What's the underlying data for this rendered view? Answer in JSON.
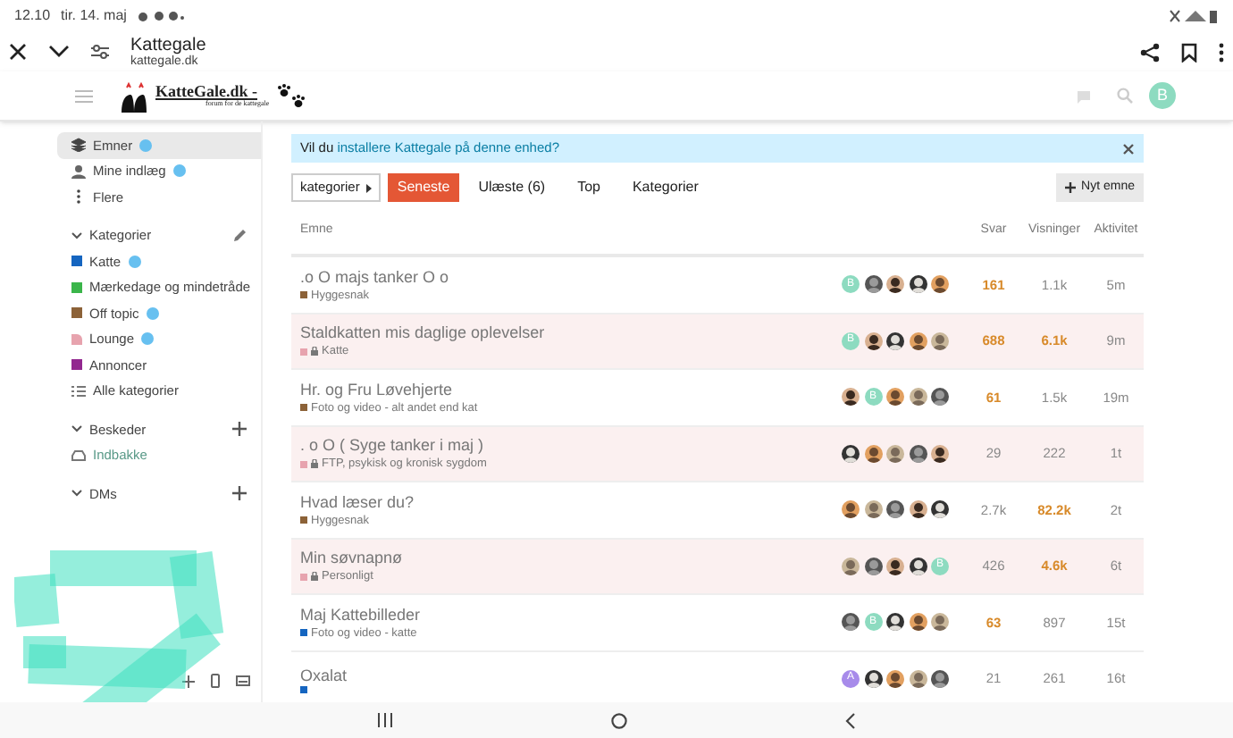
{
  "status_bar": {
    "time": "12.10",
    "date": "tir. 14. maj"
  },
  "browser": {
    "title": "Kattegale",
    "url": "kattegale.dk"
  },
  "site": {
    "logo_title": "KatteGale.dk -",
    "logo_subtitle": "forum for de kattegale",
    "user_initial": "B"
  },
  "sidebar": {
    "items": [
      {
        "label": "Emner",
        "selected": true,
        "unread": true
      },
      {
        "label": "Mine indlæg",
        "selected": false,
        "unread": true
      },
      {
        "label": "Flere",
        "selected": false,
        "unread": false
      }
    ],
    "categories_heading": "Kategorier",
    "categories": [
      {
        "label": "Katte",
        "color": "#1565c0",
        "unread": true,
        "locked": false
      },
      {
        "label": "Mærkedage og mindetråde",
        "color": "#3ab54a",
        "unread": false,
        "locked": false
      },
      {
        "label": "Off topic",
        "color": "#8c6238",
        "unread": true,
        "locked": false
      },
      {
        "label": "Lounge",
        "color": "#e7a3ae",
        "unread": true,
        "locked": true
      },
      {
        "label": "Annoncer",
        "color": "#92278f",
        "unread": false,
        "locked": false
      }
    ],
    "all_categories": "Alle kategorier",
    "messages_heading": "Beskeder",
    "inbox": "Indbakke",
    "dms_heading": "DMs"
  },
  "banner": {
    "text": "Vil du ",
    "link": "installere Kattegale på denne enhed?"
  },
  "toolbar": {
    "dropdown": "kategorier",
    "tabs": [
      {
        "label": "Seneste",
        "selected": true
      },
      {
        "label": "Ulæste (6)",
        "selected": false
      },
      {
        "label": "Top",
        "selected": false
      },
      {
        "label": "Kategorier",
        "selected": false
      }
    ],
    "new_topic": "Nyt emne"
  },
  "table": {
    "columns": [
      "Emne",
      "Svar",
      "Visninger",
      "Aktivitet"
    ],
    "rows": [
      {
        "title": ".o O majs tanker O o",
        "category": "Hyggesnak",
        "color": "#8c6238",
        "locked": false,
        "highlighted": false,
        "avatars": [
          {
            "kind": "letter",
            "letter": "B",
            "color": "#8ddbc0"
          },
          {
            "kind": "picture"
          },
          {
            "kind": "picture"
          },
          {
            "kind": "picture"
          },
          {
            "kind": "picture"
          }
        ],
        "replies": "161",
        "replies_hot": true,
        "views": "1.1k",
        "views_hot": false,
        "activity": "5m"
      },
      {
        "title": "Staldkatten mis daglige oplevelser",
        "category": "Katte",
        "color": "#e7a3ae",
        "locked": true,
        "highlighted": true,
        "avatars": [
          {
            "kind": "letter",
            "letter": "B",
            "color": "#8ddbc0"
          },
          {
            "kind": "picture"
          },
          {
            "kind": "picture"
          },
          {
            "kind": "picture"
          },
          {
            "kind": "picture"
          }
        ],
        "replies": "688",
        "replies_hot": true,
        "views": "6.1k",
        "views_hot": true,
        "activity": "9m"
      },
      {
        "title": "Hr. og Fru Løvehjerte",
        "category": "Foto og video - alt andet end kat",
        "color": "#8c6238",
        "locked": false,
        "highlighted": false,
        "avatars": [
          {
            "kind": "picture"
          },
          {
            "kind": "letter",
            "letter": "B",
            "color": "#8ddbc0"
          },
          {
            "kind": "picture"
          },
          {
            "kind": "picture"
          },
          {
            "kind": "picture"
          }
        ],
        "replies": "61",
        "replies_hot": true,
        "views": "1.5k",
        "views_hot": false,
        "activity": "19m"
      },
      {
        "title": ". o O ( Syge tanker i maj )",
        "category": "FTP, psykisk og kronisk sygdom",
        "color": "#e7a3ae",
        "locked": true,
        "highlighted": true,
        "avatars": [
          {
            "kind": "picture"
          },
          {
            "kind": "picture"
          },
          {
            "kind": "picture"
          },
          {
            "kind": "picture"
          },
          {
            "kind": "picture"
          }
        ],
        "replies": "29",
        "replies_hot": false,
        "views": "222",
        "views_hot": false,
        "activity": "1t"
      },
      {
        "title": "Hvad læser du?",
        "category": "Hyggesnak",
        "color": "#8c6238",
        "locked": false,
        "highlighted": false,
        "avatars": [
          {
            "kind": "picture"
          },
          {
            "kind": "picture"
          },
          {
            "kind": "picture"
          },
          {
            "kind": "picture"
          },
          {
            "kind": "picture"
          }
        ],
        "replies": "2.7k",
        "replies_hot": false,
        "views": "82.2k",
        "views_hot": true,
        "activity": "2t"
      },
      {
        "title": "Min søvnapnø",
        "category": "Personligt",
        "color": "#e7a3ae",
        "locked": true,
        "highlighted": true,
        "avatars": [
          {
            "kind": "picture"
          },
          {
            "kind": "picture"
          },
          {
            "kind": "picture"
          },
          {
            "kind": "picture"
          },
          {
            "kind": "letter",
            "letter": "B",
            "color": "#8ddbc0"
          }
        ],
        "replies": "426",
        "replies_hot": false,
        "views": "4.6k",
        "views_hot": true,
        "activity": "6t"
      },
      {
        "title": "Maj Kattebilleder",
        "category": "Foto og video - katte",
        "color": "#1565c0",
        "locked": false,
        "highlighted": false,
        "avatars": [
          {
            "kind": "picture"
          },
          {
            "kind": "letter",
            "letter": "B",
            "color": "#8ddbc0"
          },
          {
            "kind": "picture"
          },
          {
            "kind": "picture"
          },
          {
            "kind": "picture"
          }
        ],
        "replies": "63",
        "replies_hot": true,
        "views": "897",
        "views_hot": false,
        "activity": "15t"
      },
      {
        "title": "Oxalat",
        "color": "#1565c0",
        "locked": false,
        "highlighted": false,
        "avatars": [
          {
            "kind": "letter",
            "letter": "A",
            "color": "#a78bea"
          },
          {
            "kind": "picture"
          },
          {
            "kind": "picture"
          },
          {
            "kind": "picture"
          },
          {
            "kind": "picture"
          }
        ],
        "replies": "21",
        "replies_hot": false,
        "views": "261",
        "views_hot": false,
        "activity": "16t"
      }
    ]
  }
}
